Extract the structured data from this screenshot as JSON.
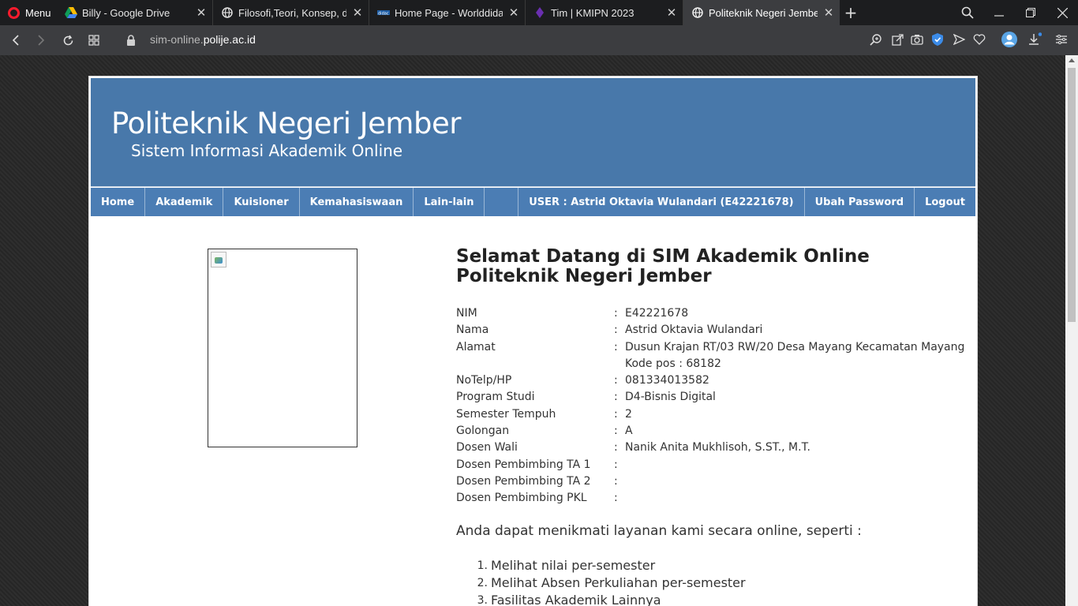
{
  "browser": {
    "menu_label": "Menu",
    "tabs": [
      {
        "title": "Billy - Google Drive",
        "icon": "google-drive-icon"
      },
      {
        "title": "Filosofi,Teori, Konsep, dan S",
        "icon": "globe-icon"
      },
      {
        "title": "Home Page - Worlddidac",
        "icon": "worlddidac-icon"
      },
      {
        "title": "Tim | KMIPN 2023",
        "icon": "kmipn-icon"
      },
      {
        "title": "Politeknik Negeri Jember",
        "icon": "globe-icon"
      }
    ],
    "url_prefix": "sim-online.",
    "url_domain": "polije.ac.id"
  },
  "site": {
    "title": "Politeknik Negeri Jember",
    "subtitle": "Sistem Informasi Akademik Online",
    "nav": {
      "home": "Home",
      "akademik": "Akademik",
      "kuisioner": "Kuisioner",
      "kemahasiswaan": "Kemahasiswaan",
      "lain": "Lain-lain",
      "user": "USER : Astrid Oktavia Wulandari (E42221678)",
      "ubah_password": "Ubah Password",
      "logout": "Logout"
    }
  },
  "main": {
    "welcome_line1": "Selamat Datang di SIM Akademik Online",
    "welcome_line2": "Politeknik Negeri Jember",
    "profile": [
      {
        "label": "NIM",
        "value": "E42221678"
      },
      {
        "label": "Nama",
        "value": "Astrid Oktavia Wulandari"
      },
      {
        "label": "Alamat",
        "value": "Dusun Krajan RT/03 RW/20 Desa Mayang Kecamatan Mayang"
      },
      {
        "label": "",
        "value": "Kode pos : 68182"
      },
      {
        "label": "NoTelp/HP",
        "value": "081334013582"
      },
      {
        "label": "Program Studi",
        "value": "D4-Bisnis Digital"
      },
      {
        "label": "Semester Tempuh",
        "value": "2"
      },
      {
        "label": "Golongan",
        "value": "A"
      },
      {
        "label": "Dosen Wali",
        "value": "Nanik Anita Mukhlisoh, S.ST., M.T."
      },
      {
        "label": "Dosen Pembimbing TA 1",
        "value": ""
      },
      {
        "label": "Dosen Pembimbing TA 2",
        "value": ""
      },
      {
        "label": "Dosen Pembimbing PKL",
        "value": ""
      }
    ],
    "separator": ":",
    "intro": "Anda dapat menikmati layanan kami secara online, seperti :",
    "services": [
      {
        "num": "1.",
        "text": "Melihat nilai per-semester"
      },
      {
        "num": "2.",
        "text": "Melihat Absen Perkuliahan per-semester"
      },
      {
        "num": "3.",
        "text": "Fasilitas Akademik Lainnya"
      }
    ]
  },
  "colors": {
    "header_bg": "#4878aa",
    "nav_bg": "#4b7db4",
    "browser_dark": "#1c1d1f",
    "opera_red": "#ff1b2d"
  }
}
